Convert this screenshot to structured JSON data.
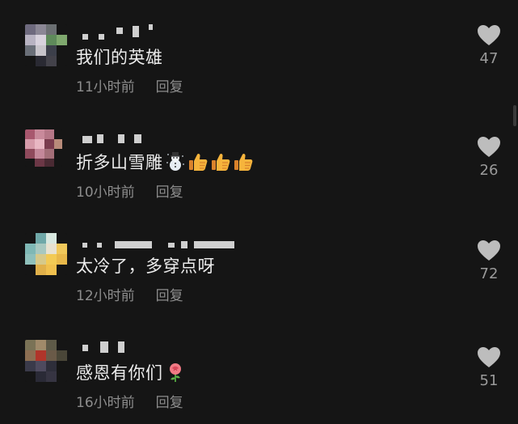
{
  "comments": [
    {
      "text": "我们的英雄",
      "time": "11小时前",
      "reply_label": "回复",
      "likes": "47",
      "emojis": []
    },
    {
      "text": "折多山雪雕",
      "time": "10小时前",
      "reply_label": "回复",
      "likes": "26",
      "emojis": [
        "snowman-icon",
        "thumbs-up-icon",
        "thumbs-up-icon",
        "thumbs-up-icon"
      ]
    },
    {
      "text": "太冷了，多穿点呀",
      "time": "12小时前",
      "reply_label": "回复",
      "likes": "72",
      "emojis": []
    },
    {
      "text": "感恩有你们",
      "time": "16小时前",
      "reply_label": "回复",
      "likes": "51",
      "emojis": [
        "rose-icon"
      ]
    }
  ],
  "colors": {
    "background": "#151515",
    "text": "#ececec",
    "meta": "#8d8d8d",
    "heart": "#bdbdbd"
  }
}
